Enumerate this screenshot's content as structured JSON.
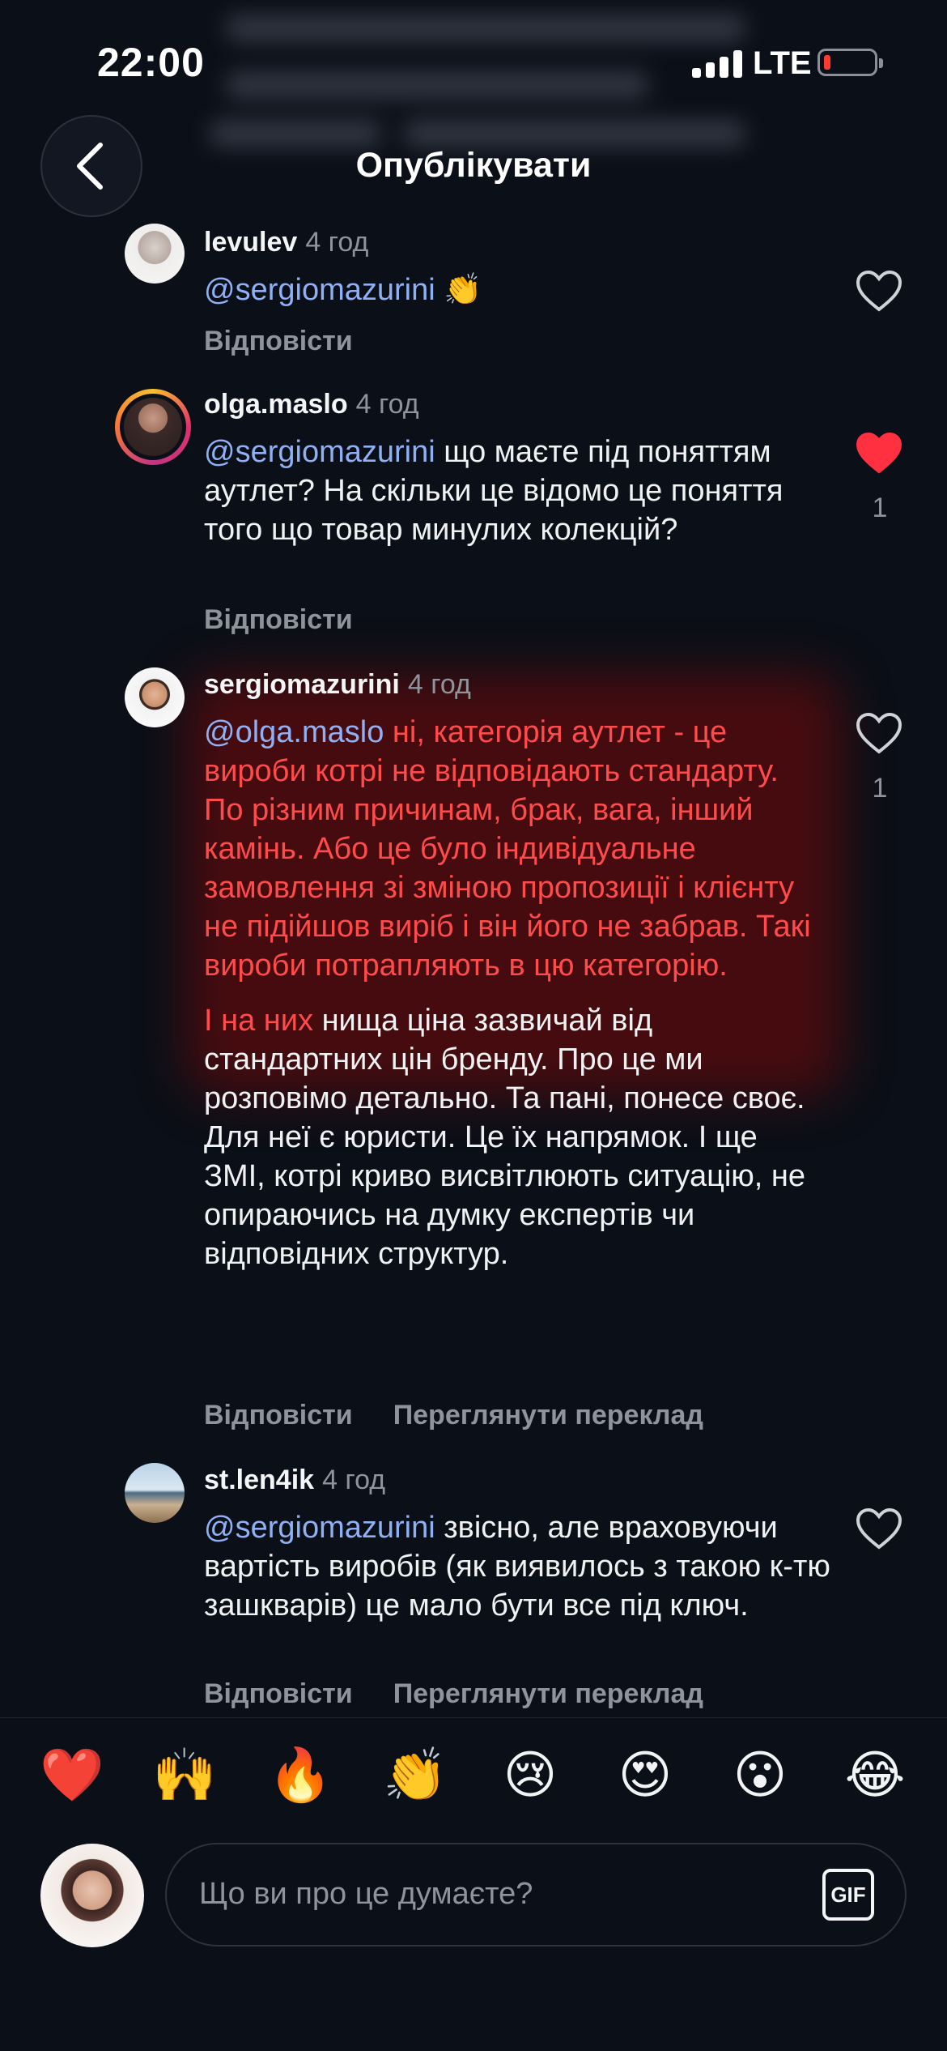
{
  "status": {
    "time": "22:00",
    "network": "LTE"
  },
  "header": {
    "title": "Опублікувати"
  },
  "comments": [
    {
      "username": "levulev",
      "ago": "4 год",
      "mention": "@sergiomazurini",
      "text": " 👏",
      "reply": "Відповісти",
      "liked": false
    },
    {
      "username": "olga.maslo",
      "ago": "4 год",
      "mention": "@sergiomazurini",
      "text": " що маєте під поняттям аутлет? На скільки це відомо це поняття того що товар минулих колекцій?",
      "reply": "Відповісти",
      "liked": true,
      "likes": "1"
    },
    {
      "username": "sergiomazurini",
      "ago": "4 год",
      "mention": "@olga.maslo",
      "text_highlight": " ні, категорія аутлет - це вироби котрі не відповідають стандарту. По різним причинам, брак, вага, інший камінь. Або це було індивідуальне замовлення зі зміною пропозиції і клієнту не підійшов виріб і він його не забрав. Такі вироби потрапляють в цю категорію.",
      "text_highlight_2": "І на них",
      "text": " нища ціна зазвичай від стандартних цін бренду. Про це ми розповімо детально. Та пані, понесе своє. Для неї є юристи. Це їх напрямок. І ще ЗМІ, котрі криво висвітлюють ситуацію, не опираючись на думку експертів чи відповідних структур.",
      "reply": "Відповісти",
      "translate": "Переглянути переклад",
      "liked": false,
      "likes": "1"
    },
    {
      "username": "st.len4ik",
      "ago": "4 год",
      "mention": "@sergiomazurini",
      "text": " звісно, але враховуючи вартість виробів (як виявилось з такою к-тю зашкварів) це мало бути все під ключ.",
      "reply": "Відповісти",
      "translate": "Переглянути переклад",
      "liked": false
    }
  ],
  "reactions": [
    "❤️",
    "🙌",
    "🔥",
    "👏",
    "😢",
    "😍",
    "😮",
    "😂"
  ],
  "composer": {
    "placeholder": "Що ви про це думаєте?",
    "gif_label": "GIF"
  },
  "colors": {
    "background": "#0b0f17",
    "mention": "#8fb0f5",
    "highlight_text": "#ff4b4b",
    "liked_heart": "#ff3040"
  }
}
